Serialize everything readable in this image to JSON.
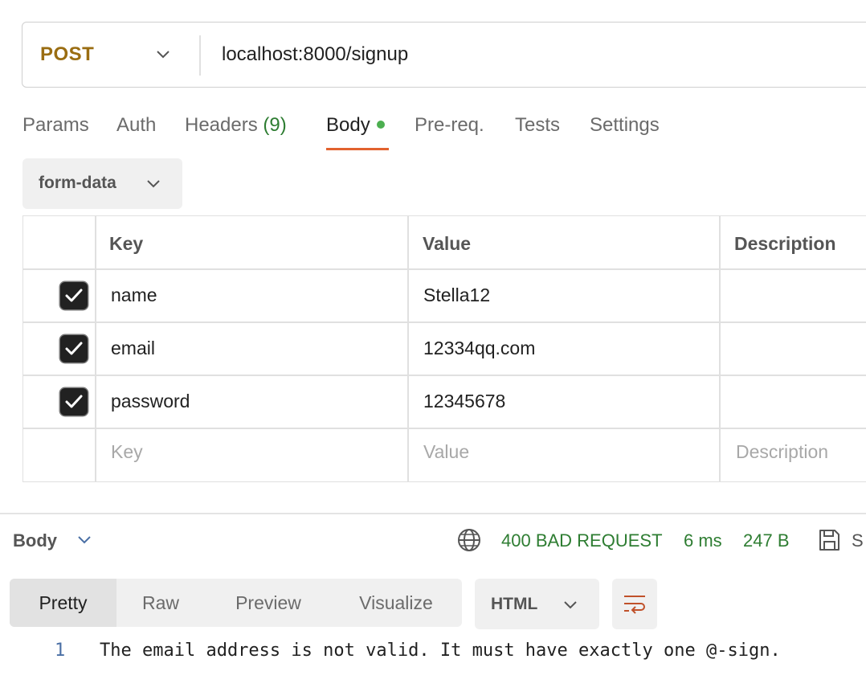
{
  "request": {
    "method": "POST",
    "url": "localhost:8000/signup"
  },
  "tabs": {
    "params": "Params",
    "auth": "Auth",
    "headers": "Headers",
    "headers_count": "(9)",
    "body": "Body",
    "prereq": "Pre-req.",
    "tests": "Tests",
    "settings": "Settings"
  },
  "body_type": "form-data",
  "table": {
    "headers": {
      "key": "Key",
      "value": "Value",
      "description": "Description"
    },
    "rows": [
      {
        "key": "name",
        "value": "Stella12",
        "checked": true
      },
      {
        "key": "email",
        "value": "12334qq.com",
        "checked": true
      },
      {
        "key": "password",
        "value": "12345678",
        "checked": true
      }
    ],
    "placeholders": {
      "key": "Key",
      "value": "Value",
      "description": "Description"
    }
  },
  "response": {
    "label": "Body",
    "status": "400 BAD REQUEST",
    "time": "6 ms",
    "size": "247 B",
    "save_label": "S",
    "status_color": "#2e7d32",
    "view_tabs": [
      "Pretty",
      "Raw",
      "Preview",
      "Visualize"
    ],
    "format": "HTML",
    "lines": [
      {
        "no": "1",
        "text": "The email address is not valid. It must have exactly one @-sign."
      }
    ]
  },
  "colors": {
    "method": "#9a6d12",
    "active_tab_underline": "#e2622e",
    "body_dot": "#4caf50",
    "wrap_icon": "#c0512a"
  }
}
